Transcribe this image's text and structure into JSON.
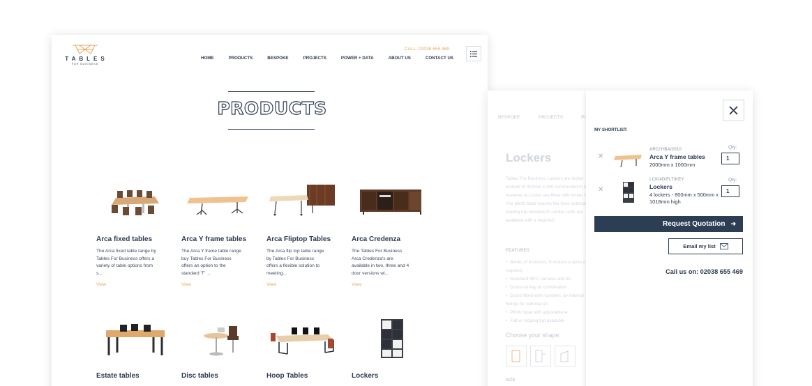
{
  "header": {
    "logo_word": "TABLES",
    "logo_sub": "FOR BUSINESS",
    "call": "CALL: 02038 655 469",
    "nav": [
      "HOME",
      "PRODUCTS",
      "BESPOKE",
      "PROJECTS",
      "POWER + DATA",
      "ABOUT US",
      "CONTACT US"
    ],
    "menu_icon": "list-icon"
  },
  "page_title": "PRODUCTS",
  "products": [
    {
      "name": "Arca fixed tables",
      "desc": "The Arca fixed table range by Tables For Business offers a variety of table options from s...",
      "view": "View"
    },
    {
      "name": "Arca Y frame tables",
      "desc": "The Arca Y frame table range buy Tables For Business offers an option to the standard 'T' ...",
      "view": "View"
    },
    {
      "name": "Arca Fliptop Tables",
      "desc": "The Arca flip top table range by Tables For Business offers a flexible solution to meeting...",
      "view": "View"
    },
    {
      "name": "Arca Credenza",
      "desc": "The Tables For Business Arca Credenza's are available in two, three and 4 door versions wi...",
      "view": "View"
    },
    {
      "name": "Estate tables"
    },
    {
      "name": "Disc tables"
    },
    {
      "name": "Hoop Tables"
    },
    {
      "name": "Lockers"
    }
  ],
  "detail_page": {
    "nav": [
      "BESPOKE",
      "PROJECTS",
      "PO"
    ],
    "title": "Lockers",
    "intro": "Tables For Business Lockers are locker module of 400mm x 400 constructed in MFC, however la Locker are fitted with locker num The plinth base insures the lowe optional sloping top elevates th Locker units are available with a required.",
    "features_heading": "FEATURES",
    "features": [
      "Banks of 4 lockers, 6 lockers a sizes on request)",
      "Standard MFC carcase and do",
      "Doors on key or combination",
      "Doors fitted with numbers, av internal fixings for optional sh",
      "Plinth base with adjustable le",
      "Flat or sloping top available"
    ],
    "shape_heading": "Choose your shape:",
    "size_heading": "SIZE"
  },
  "shortlist": {
    "title": "MY SHORTLIST:",
    "close_icon": "close-icon",
    "items": [
      {
        "code": "ARC/Y/BA/2010",
        "name": "Arca Y frame tables",
        "dims": "2000mm x 1000mm",
        "qty_label": "Qty:",
        "qty": "1"
      },
      {
        "code": "LCK/4D/FLT/KEY",
        "name": "Lockers",
        "dims": "4 lockers - 800mm x 500mm x 1018mm high",
        "qty_label": "Qty:",
        "qty": "1"
      }
    ],
    "request_label": "Request Quotation",
    "email_label": "Email my list",
    "call_label": "Call us on: 02038 655 469"
  },
  "colors": {
    "navy": "#2c3d54",
    "accent": "#e8a557"
  }
}
